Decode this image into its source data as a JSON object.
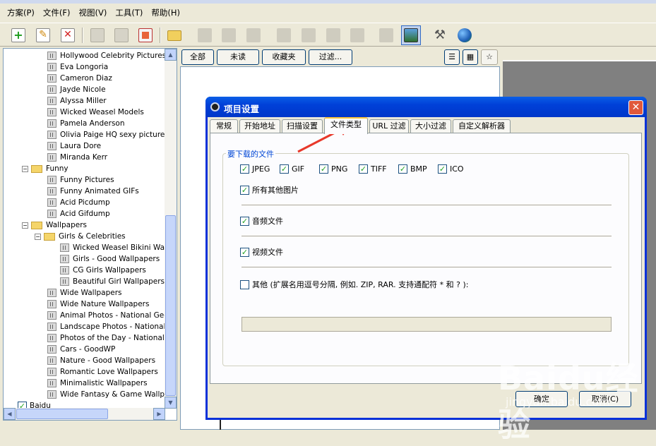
{
  "menu": [
    "方案(P)",
    "文件(F)",
    "视图(V)",
    "工具(T)",
    "帮助(H)"
  ],
  "tree": [
    {
      "label": "Hollywood Celebrity Pictures",
      "kind": "item",
      "indent": 3
    },
    {
      "label": "Eva Longoria",
      "kind": "item",
      "indent": 3
    },
    {
      "label": "Cameron Diaz",
      "kind": "item",
      "indent": 3
    },
    {
      "label": "Jayde Nicole",
      "kind": "item",
      "indent": 3
    },
    {
      "label": "Alyssa Miller",
      "kind": "item",
      "indent": 3
    },
    {
      "label": "Wicked Weasel Models",
      "kind": "item",
      "indent": 3
    },
    {
      "label": "Pamela Anderson",
      "kind": "item",
      "indent": 3
    },
    {
      "label": "Olivia Paige HQ sexy pictures",
      "kind": "item",
      "indent": 3
    },
    {
      "label": "Laura Dore",
      "kind": "item",
      "indent": 3
    },
    {
      "label": "Miranda Kerr",
      "kind": "item",
      "indent": 3
    },
    {
      "label": "Funny",
      "kind": "folder",
      "indent": 1
    },
    {
      "label": "Funny Pictures",
      "kind": "item",
      "indent": 3
    },
    {
      "label": "Funny Animated GIFs",
      "kind": "item",
      "indent": 3
    },
    {
      "label": "Acid Picdump",
      "kind": "item",
      "indent": 3
    },
    {
      "label": "Acid Gifdump",
      "kind": "item",
      "indent": 3
    },
    {
      "label": "Wallpapers",
      "kind": "folder",
      "indent": 1
    },
    {
      "label": "Girls & Celebrities",
      "kind": "folder",
      "indent": 2
    },
    {
      "label": "Wicked Weasel Bikini Wallpa",
      "kind": "item",
      "indent": 4
    },
    {
      "label": "Girls - Good Wallpapers",
      "kind": "item",
      "indent": 4
    },
    {
      "label": "CG Girls Wallpapers",
      "kind": "item",
      "indent": 4
    },
    {
      "label": "Beautiful Girl Wallpapers",
      "kind": "item",
      "indent": 4
    },
    {
      "label": "Wide Wallpapers",
      "kind": "item",
      "indent": 3
    },
    {
      "label": "Wide Nature Wallpapers",
      "kind": "item",
      "indent": 3
    },
    {
      "label": "Animal Photos - National Geogr",
      "kind": "item",
      "indent": 3
    },
    {
      "label": "Landscape Photos - National Ge",
      "kind": "item",
      "indent": 3
    },
    {
      "label": "Photos of the Day - National Ge",
      "kind": "item",
      "indent": 3
    },
    {
      "label": "Cars - GoodWP",
      "kind": "item",
      "indent": 3
    },
    {
      "label": "Nature - Good Wallpapers",
      "kind": "item",
      "indent": 3
    },
    {
      "label": "Romantic Love Wallpapers",
      "kind": "item",
      "indent": 3
    },
    {
      "label": "Minimalistic Wallpapers",
      "kind": "item",
      "indent": 3
    },
    {
      "label": "Wide Fantasy & Game Wallpape",
      "kind": "item",
      "indent": 3
    },
    {
      "label": "Baidu",
      "kind": "checked",
      "indent": 0
    }
  ],
  "filters": [
    "全部",
    "未读",
    "收藏夹",
    "过滤..."
  ],
  "dialog": {
    "title": "项目设置",
    "tabs": [
      "常规",
      "开始地址",
      "扫描设置",
      "文件类型",
      "URL 过滤",
      "大小过滤",
      "自定义解析器"
    ],
    "active_tab": "文件类型",
    "group_title": "要下载的文件",
    "types": [
      "JPEG",
      "GIF",
      "PNG",
      "TIFF",
      "BMP",
      "ICO"
    ],
    "all_images": "所有其他图片",
    "audio": "音频文件",
    "video": "视频文件",
    "other": "其他 (扩展名用逗号分隔, 例如. ZIP, RAR. 支持通配符 * 和 ? ):",
    "ok": "确定",
    "cancel": "取消(C)"
  },
  "watermark": {
    "brand": "Baidu经验",
    "url": "jingyan.baidu.com"
  }
}
